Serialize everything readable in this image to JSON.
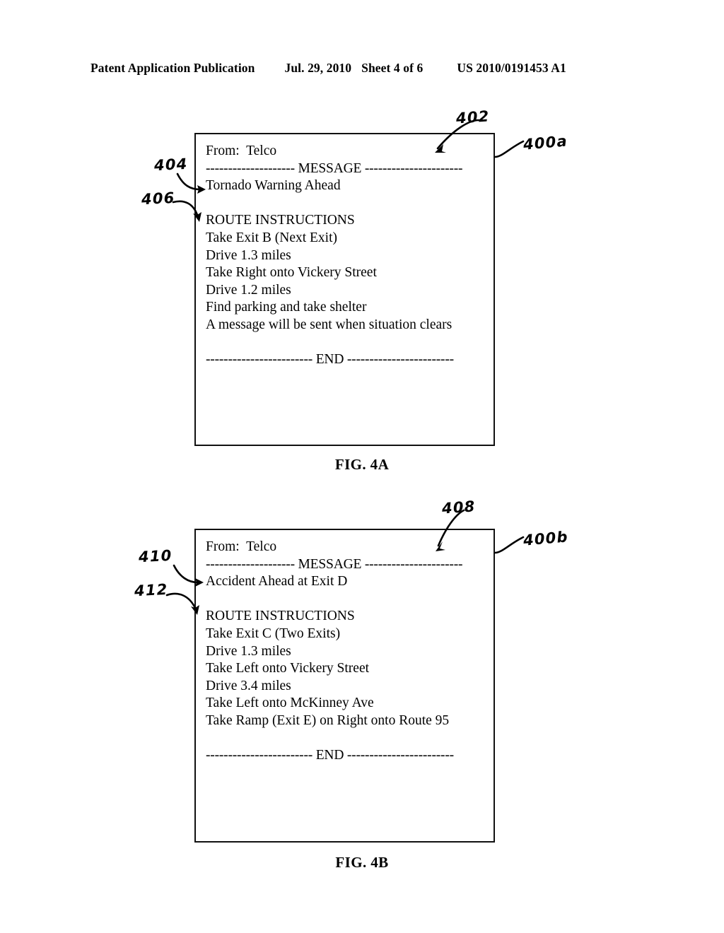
{
  "header": {
    "title": "Patent Application Publication",
    "date": "Jul. 29, 2010",
    "sheet": "Sheet 4 of 6",
    "patent_number": "US 2010/0191453 A1"
  },
  "figures": [
    {
      "id": "fig-4a",
      "caption": "FIG. 4A",
      "refs": {
        "box": "400a",
        "message_pointer": "402",
        "message_text": "404",
        "route_instructions": "406"
      },
      "message": {
        "from_label": "From:  Telco",
        "message_separator": "-------------------- MESSAGE ----------------------",
        "alert_text": "Tornado Warning Ahead",
        "instructions_heading": "ROUTE INSTRUCTIONS",
        "instructions": [
          "Take Exit B (Next Exit)",
          "Drive 1.3 miles",
          "Take Right onto Vickery Street",
          "Drive 1.2 miles",
          "Find parking and take shelter",
          "A message will be sent when situation clears"
        ],
        "end_separator": "------------------------ END ------------------------"
      }
    },
    {
      "id": "fig-4b",
      "caption": "FIG. 4B",
      "refs": {
        "box": "400b",
        "message_pointer": "408",
        "message_text": "410",
        "route_instructions": "412"
      },
      "message": {
        "from_label": "From:  Telco",
        "message_separator": "-------------------- MESSAGE ----------------------",
        "alert_text": "Accident Ahead at Exit D",
        "instructions_heading": "ROUTE INSTRUCTIONS",
        "instructions": [
          "Take Exit C (Two Exits)",
          "Drive 1.3 miles",
          "Take Left onto Vickery Street",
          "Drive 3.4 miles",
          "Take Left onto McKinney Ave",
          "Take Ramp (Exit E) on Right onto Route 95"
        ],
        "end_separator": "------------------------ END ------------------------"
      }
    }
  ]
}
